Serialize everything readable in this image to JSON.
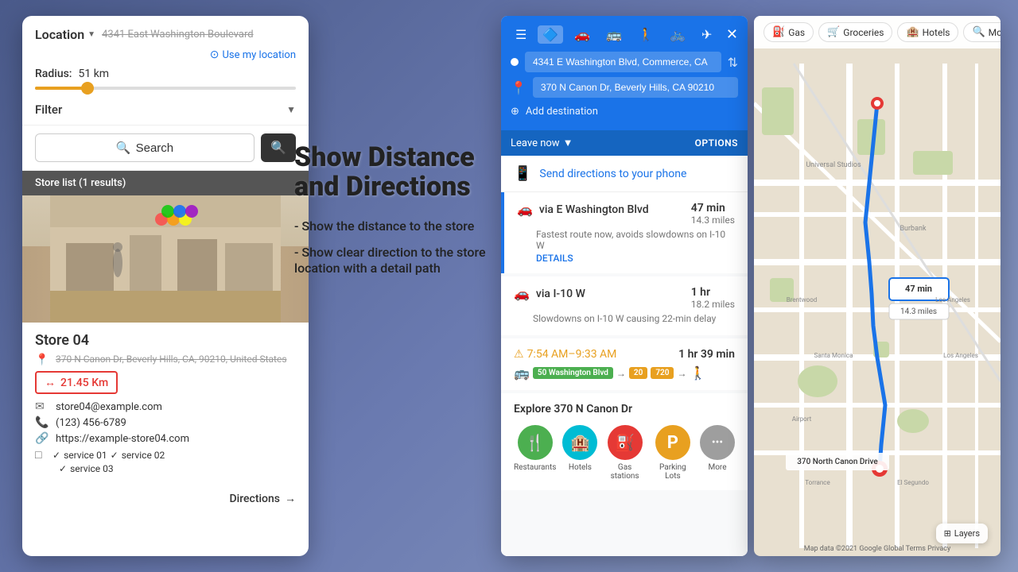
{
  "left_panel": {
    "location_label": "Location",
    "location_address": "4341 East Washington Boulevard",
    "use_location_text": "Use my location",
    "radius_label": "Radius:",
    "radius_value": "51 km",
    "filter_label": "Filter",
    "search_label": "Search",
    "store_list_header": "Store list (1 results)",
    "store": {
      "name": "Store 04",
      "address": "370 N Canon Dr, Beverly Hills, CA, 90210, United States",
      "distance": "21.45 Km",
      "email": "store04@example.com",
      "phone": "(123) 456-6789",
      "website": "https://example-store04.com",
      "services": [
        "service 01",
        "service 02",
        "service 03"
      ]
    },
    "directions_label": "Directions"
  },
  "center_text": {
    "title": "Show Distance and Directions",
    "bullet1": "- Show the distance to the store",
    "bullet2": "- Show clear direction to the store location with a detail path"
  },
  "directions_panel": {
    "origin": "4341 E Washington Blvd, Commerce, CA",
    "destination": "370 N Canon Dr, Beverly Hills, CA 90210",
    "add_destination": "Add destination",
    "leave_now": "Leave now",
    "options_label": "OPTIONS",
    "send_directions": "Send directions to your phone",
    "routes": [
      {
        "name": "via E Washington Blvd",
        "time": "47 min",
        "distance": "14.3 miles",
        "description": "Fastest route now, avoids slowdowns on I-10 W",
        "details_label": "DETAILS"
      },
      {
        "name": "via I-10 W",
        "time": "1 hr",
        "distance": "18.2 miles",
        "description": "Slowdowns on I-10 W causing 22-min delay"
      }
    ],
    "transit": {
      "time_range": "7:54 AM–9:33 AM",
      "duration": "1 hr 39 min",
      "badges": [
        "50 Washington Blvd",
        "20",
        "720"
      ]
    },
    "explore_title": "Explore 370 N Canon Dr",
    "explore_items": [
      {
        "label": "Restaurants",
        "icon": "🍴",
        "color": "#4CAF50"
      },
      {
        "label": "Hotels",
        "icon": "🏨",
        "color": "#00BCD4"
      },
      {
        "label": "Gas stations",
        "icon": "⛽",
        "color": "#e53935"
      },
      {
        "label": "Parking Lots",
        "icon": "P",
        "color": "#e8a020"
      },
      {
        "label": "More",
        "icon": "•••",
        "color": "#9e9e9e"
      }
    ]
  },
  "map_panel": {
    "filter_chips": [
      {
        "label": "Gas",
        "icon": "⛽"
      },
      {
        "label": "Groceries",
        "icon": "🛒"
      },
      {
        "label": "Hotels",
        "icon": "🏨"
      },
      {
        "label": "More",
        "icon": "🔍"
      }
    ],
    "pin_label": "370 North Canon Drive",
    "time_badge": "47 min",
    "distance_badge": "14.3 miles",
    "layers_label": "Layers",
    "attribution": "Map data ©2021 Google  Global  Terms  Privacy"
  }
}
